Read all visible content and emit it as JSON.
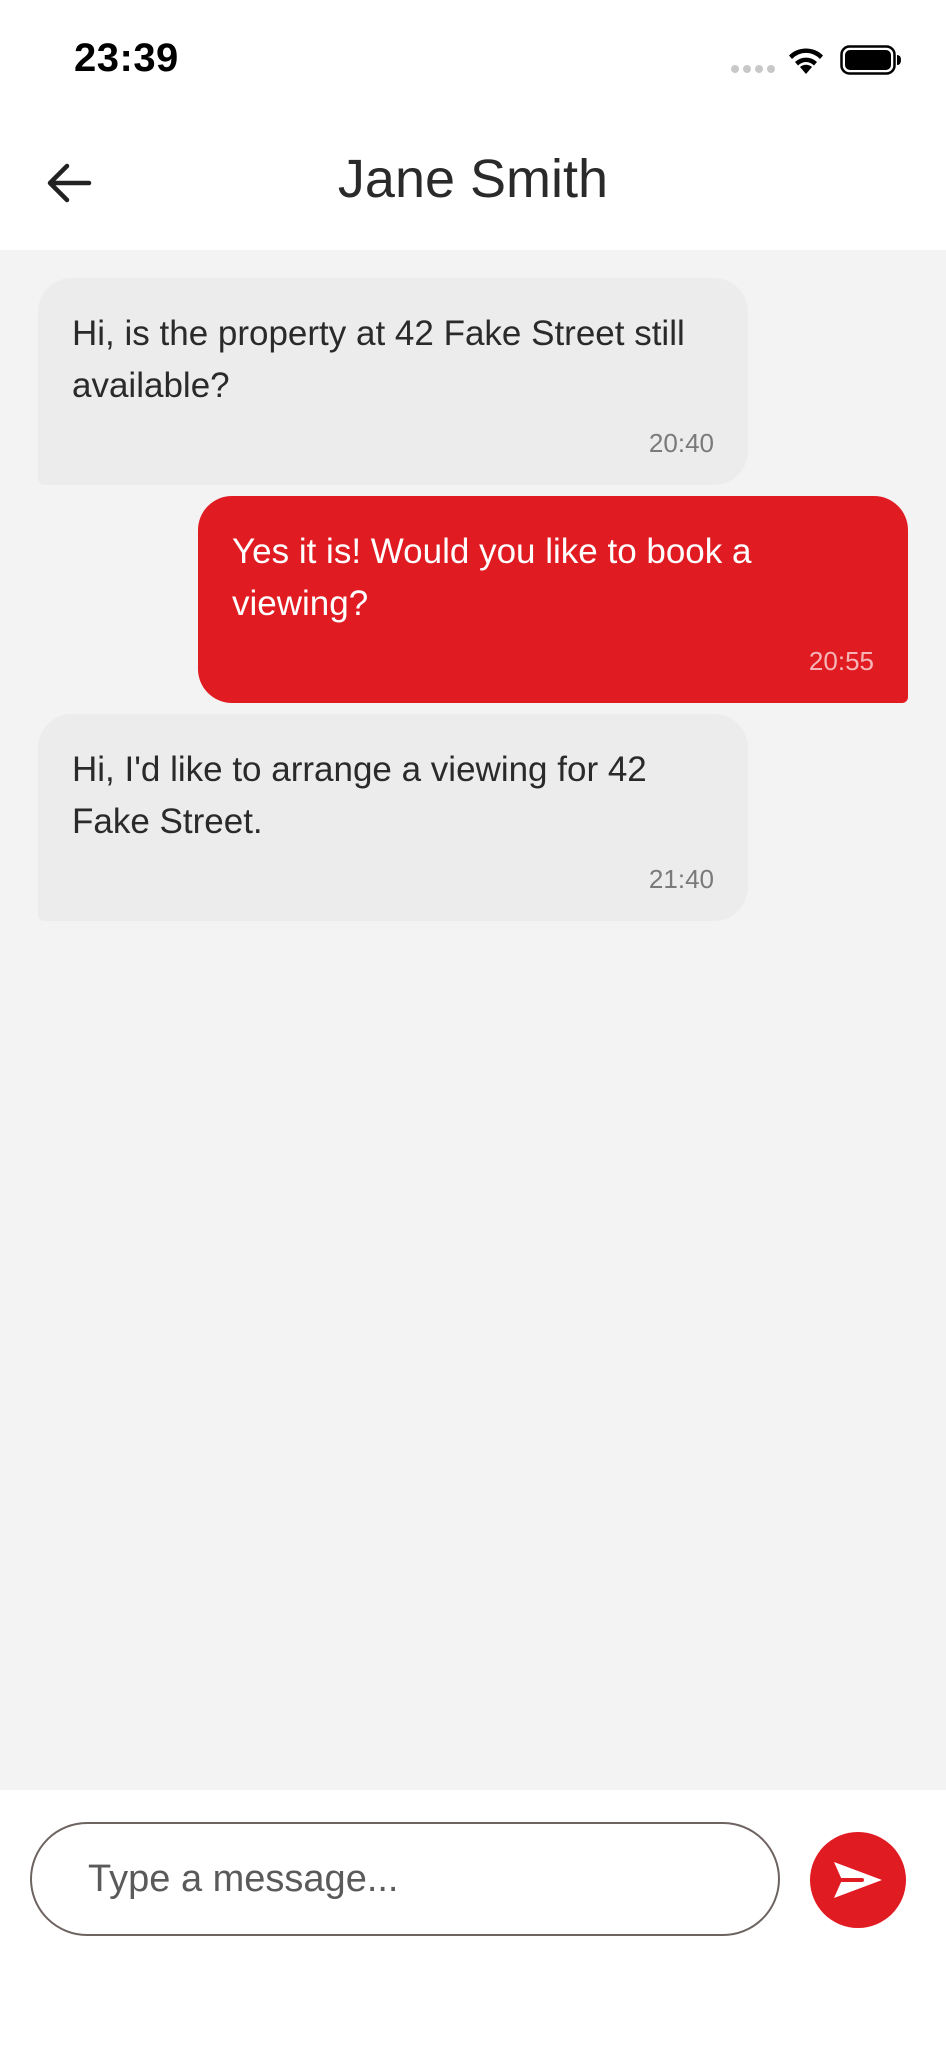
{
  "status_bar": {
    "time": "23:39",
    "icons": [
      "signal-icon",
      "wifi-icon",
      "battery-icon"
    ]
  },
  "header": {
    "title": "Jane Smith",
    "back_icon": "arrow-left-icon"
  },
  "messages": [
    {
      "direction": "incoming",
      "text": "Hi, is the property at 42 Fake Street still available?",
      "time": "20:40"
    },
    {
      "direction": "outgoing",
      "text": "Yes it is! Would you like to book a viewing?",
      "time": "20:55"
    },
    {
      "direction": "incoming",
      "text": "Hi, I'd like to arrange a viewing for 42 Fake Street.",
      "time": "21:40"
    }
  ],
  "composer": {
    "placeholder": "Type a message...",
    "value": "",
    "send_icon": "send-icon"
  },
  "colors": {
    "accent": "#e11b22",
    "incoming_bubble": "#ececec",
    "chat_background": "#f3f3f3"
  }
}
